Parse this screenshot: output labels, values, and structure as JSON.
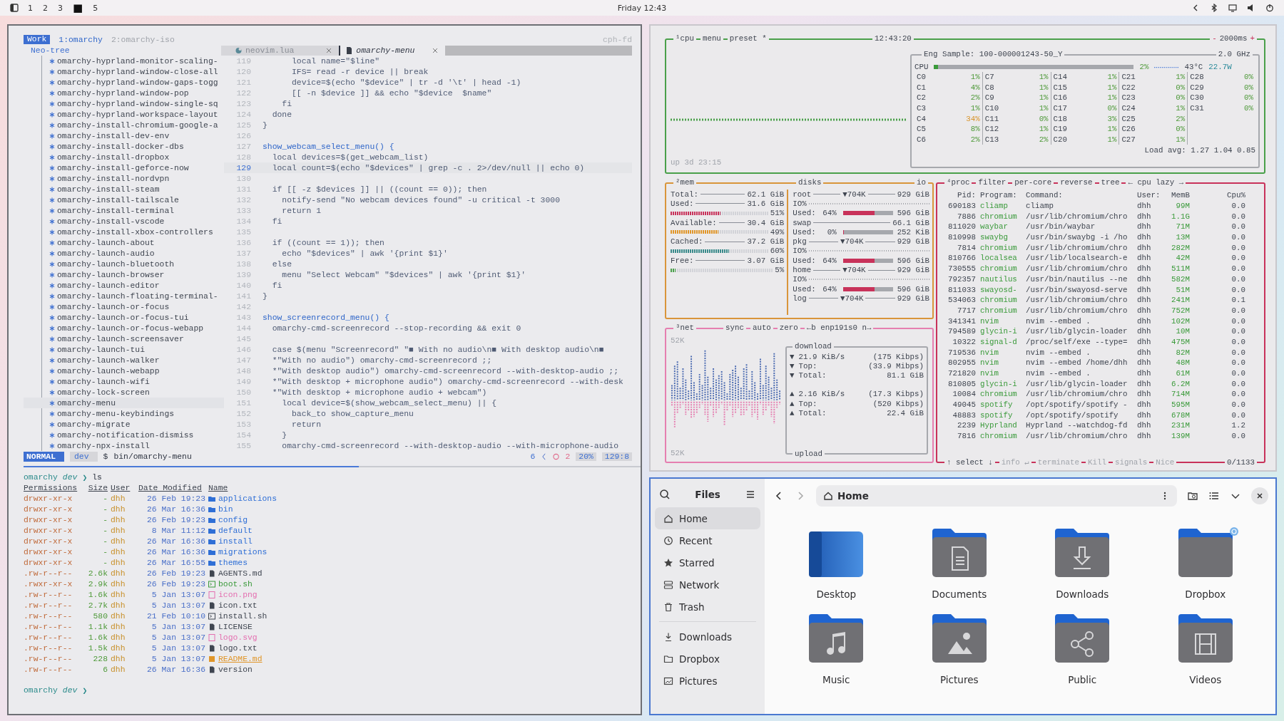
{
  "topbar": {
    "workspaces": [
      {
        "label": "1",
        "selected": false
      },
      {
        "label": "2",
        "selected": false
      },
      {
        "label": "3",
        "selected": false
      },
      {
        "label": "■",
        "selected": true
      },
      {
        "label": "5",
        "selected": false
      }
    ],
    "clock": "Friday 12:43"
  },
  "nvim": {
    "session": "Work",
    "windows": [
      {
        "label": "1:omarchy",
        "selected": true
      },
      {
        "label": "2:omarchy-iso",
        "selected": false
      }
    ],
    "host": "cph-fd",
    "tree_title": "Neo-tree",
    "buffers": [
      {
        "label": "neovim.lua",
        "selected": false
      },
      {
        "label": "omarchy-menu",
        "selected": true
      }
    ],
    "tree": [
      {
        "label": "omarchy-hyprland-monitor-scaling-",
        "selected": false
      },
      {
        "label": "omarchy-hyprland-window-close-all",
        "selected": false
      },
      {
        "label": "omarchy-hyprland-window-gaps-togg",
        "selected": false
      },
      {
        "label": "omarchy-hyprland-window-pop",
        "selected": false
      },
      {
        "label": "omarchy-hyprland-window-single-sq",
        "selected": false
      },
      {
        "label": "omarchy-hyprland-workspace-layout",
        "selected": false
      },
      {
        "label": "omarchy-install-chromium-google-a",
        "selected": false
      },
      {
        "label": "omarchy-install-dev-env",
        "selected": false
      },
      {
        "label": "omarchy-install-docker-dbs",
        "selected": false
      },
      {
        "label": "omarchy-install-dropbox",
        "selected": false
      },
      {
        "label": "omarchy-install-geforce-now",
        "selected": false
      },
      {
        "label": "omarchy-install-nordvpn",
        "selected": false
      },
      {
        "label": "omarchy-install-steam",
        "selected": false
      },
      {
        "label": "omarchy-install-tailscale",
        "selected": false
      },
      {
        "label": "omarchy-install-terminal",
        "selected": false
      },
      {
        "label": "omarchy-install-vscode",
        "selected": false
      },
      {
        "label": "omarchy-install-xbox-controllers",
        "selected": false
      },
      {
        "label": "omarchy-launch-about",
        "selected": false
      },
      {
        "label": "omarchy-launch-audio",
        "selected": false
      },
      {
        "label": "omarchy-launch-bluetooth",
        "selected": false
      },
      {
        "label": "omarchy-launch-browser",
        "selected": false
      },
      {
        "label": "omarchy-launch-editor",
        "selected": false
      },
      {
        "label": "omarchy-launch-floating-terminal-",
        "selected": false
      },
      {
        "label": "omarchy-launch-or-focus",
        "selected": false
      },
      {
        "label": "omarchy-launch-or-focus-tui",
        "selected": false
      },
      {
        "label": "omarchy-launch-or-focus-webapp",
        "selected": false
      },
      {
        "label": "omarchy-launch-screensaver",
        "selected": false
      },
      {
        "label": "omarchy-launch-tui",
        "selected": false
      },
      {
        "label": "omarchy-launch-walker",
        "selected": false
      },
      {
        "label": "omarchy-launch-webapp",
        "selected": false
      },
      {
        "label": "omarchy-launch-wifi",
        "selected": false
      },
      {
        "label": "omarchy-lock-screen",
        "selected": false
      },
      {
        "label": "omarchy-menu",
        "selected": true
      },
      {
        "label": "omarchy-menu-keybindings",
        "selected": false
      },
      {
        "label": "omarchy-migrate",
        "selected": false
      },
      {
        "label": "omarchy-notification-dismiss",
        "selected": false
      },
      {
        "label": "omarchy-npx-install",
        "selected": false
      }
    ],
    "code": [
      {
        "n": "119",
        "text": "      local name=\"$line\"",
        "kind": "code",
        "current": false
      },
      {
        "n": "120",
        "text": "      IFS= read -r device || break",
        "kind": "code",
        "current": false
      },
      {
        "n": "121",
        "text": "      device=$(echo \"$device\" | tr -d '\\t' | head -1)",
        "kind": "code",
        "current": false
      },
      {
        "n": "122",
        "text": "      [[ -n $device ]] && echo \"$device  $name\"",
        "kind": "code",
        "current": false
      },
      {
        "n": "123",
        "text": "    fi",
        "kind": "code",
        "current": false
      },
      {
        "n": "124",
        "text": "  done",
        "kind": "code",
        "current": false
      },
      {
        "n": "125",
        "text": "}",
        "kind": "code",
        "current": false
      },
      {
        "n": "126",
        "current": false
      },
      {
        "n": "127",
        "text": "show_webcam_select_menu() {",
        "kind": "def",
        "current": false
      },
      {
        "n": "128",
        "text": "  local devices=$(get_webcam_list)",
        "kind": "code",
        "current": false
      },
      {
        "n": "129",
        "text": "  local count=$(echo \"$devices\" | grep -c . 2>/dev/null || echo 0)",
        "kind": "code",
        "current": true
      },
      {
        "n": "130",
        "current": false
      },
      {
        "n": "131",
        "text": "  if [[ -z $devices ]] || ((count == 0)); then",
        "kind": "code",
        "current": false
      },
      {
        "n": "132",
        "text": "    notify-send \"No webcam devices found\" -u critical -t 3000",
        "kind": "code",
        "current": false
      },
      {
        "n": "133",
        "text": "    return 1",
        "kind": "code",
        "current": false
      },
      {
        "n": "134",
        "text": "  fi",
        "kind": "code",
        "current": false
      },
      {
        "n": "135",
        "current": false
      },
      {
        "n": "136",
        "text": "  if ((count == 1)); then",
        "kind": "code",
        "current": false
      },
      {
        "n": "137",
        "text": "    echo \"$devices\" | awk '{print $1}'",
        "kind": "code",
        "current": false
      },
      {
        "n": "138",
        "text": "  else",
        "kind": "code",
        "current": false
      },
      {
        "n": "139",
        "text": "    menu \"Select Webcam\" \"$devices\" | awk '{print $1}'",
        "kind": "code",
        "current": false
      },
      {
        "n": "140",
        "text": "  fi",
        "kind": "code",
        "current": false
      },
      {
        "n": "141",
        "text": "}",
        "kind": "code",
        "current": false
      },
      {
        "n": "142",
        "current": false
      },
      {
        "n": "143",
        "text": "show_screenrecord_menu() {",
        "kind": "def",
        "current": false
      },
      {
        "n": "144",
        "text": "  omarchy-cmd-screenrecord --stop-recording && exit 0",
        "kind": "code",
        "current": false
      },
      {
        "n": "145",
        "current": false
      },
      {
        "n": "146",
        "text": "  case $(menu \"Screenrecord\" \"■ With no audio\\n■ With desktop audio\\n■",
        "kind": "code",
        "current": false
      },
      {
        "n": "147",
        "text": "  *\"With no audio\") omarchy-cmd-screenrecord ;;",
        "kind": "code",
        "current": false
      },
      {
        "n": "148",
        "text": "  *\"With desktop audio\") omarchy-cmd-screenrecord --with-desktop-audio ;;",
        "kind": "code",
        "current": false
      },
      {
        "n": "149",
        "text": "  *\"With desktop + microphone audio\") omarchy-cmd-screenrecord --with-desk",
        "kind": "code",
        "current": false
      },
      {
        "n": "150",
        "text": "  *\"With desktop + microphone audio + webcam\")",
        "kind": "code",
        "current": false
      },
      {
        "n": "151",
        "text": "    local device=$(show_webcam_select_menu) || {",
        "kind": "code",
        "current": false
      },
      {
        "n": "152",
        "text": "      back_to show_capture_menu",
        "kind": "code",
        "current": false
      },
      {
        "n": "153",
        "text": "      return",
        "kind": "code",
        "current": false
      },
      {
        "n": "154",
        "text": "    }",
        "kind": "code",
        "current": false
      },
      {
        "n": "155",
        "text": "    omarchy-cmd-screenrecord --with-desktop-audio --with-microphone-audio",
        "kind": "code",
        "current": false
      }
    ],
    "status": {
      "mode": "NORMAL",
      "branch": "dev",
      "filetype": "$",
      "file": "bin/omarchy-menu",
      "count": "6",
      "diagnostics": "2",
      "percent": "20%",
      "position": "129:8"
    }
  },
  "terminal": {
    "prompt": {
      "dir": "omarchy",
      "branch": "dev",
      "symbol": "❯",
      "command": "ls"
    },
    "columns": [
      "Permissions",
      "Size",
      "User",
      "Date Modified",
      "Name"
    ],
    "rows": [
      {
        "perms": "drwxr-xr-x",
        "size": "-",
        "user": "dhh",
        "date": "26 Feb 19:23",
        "name": "applications",
        "kind": "dir"
      },
      {
        "perms": "drwxr-xr-x",
        "size": "-",
        "user": "dhh",
        "date": "26 Mar 16:36",
        "name": "bin",
        "kind": "dir"
      },
      {
        "perms": "drwxr-xr-x",
        "size": "-",
        "user": "dhh",
        "date": "26 Feb 19:23",
        "name": "config",
        "kind": "dir"
      },
      {
        "perms": "drwxr-xr-x",
        "size": "-",
        "user": "dhh",
        "date": "8 Mar 11:12",
        "name": "default",
        "kind": "dir"
      },
      {
        "perms": "drwxr-xr-x",
        "size": "-",
        "user": "dhh",
        "date": "26 Mar 16:36",
        "name": "install",
        "kind": "dir"
      },
      {
        "perms": "drwxr-xr-x",
        "size": "-",
        "user": "dhh",
        "date": "26 Mar 16:36",
        "name": "migrations",
        "kind": "dir"
      },
      {
        "perms": "drwxr-xr-x",
        "size": "-",
        "user": "dhh",
        "date": "26 Mar 16:55",
        "name": "themes",
        "kind": "dir"
      },
      {
        "perms": ".rw-r--r--",
        "size": "2.6k",
        "user": "dhh",
        "date": "26 Feb 19:23",
        "name": "AGENTS.md",
        "kind": "doc"
      },
      {
        "perms": ".rwxr-xr-x",
        "size": "2.9k",
        "user": "dhh",
        "date": "26 Feb 19:23",
        "name": "boot.sh",
        "kind": "exec"
      },
      {
        "perms": ".rw-r--r--",
        "size": "1.6k",
        "user": "dhh",
        "date": "5 Jan 13:07",
        "name": "icon.png",
        "kind": "image"
      },
      {
        "perms": ".rw-r--r--",
        "size": "2.7k",
        "user": "dhh",
        "date": "5 Jan 13:07",
        "name": "icon.txt",
        "kind": "text"
      },
      {
        "perms": ".rw-r--r--",
        "size": "580",
        "user": "dhh",
        "date": "21 Feb 10:10",
        "name": "install.sh",
        "kind": "script"
      },
      {
        "perms": ".rw-r--r--",
        "size": "1.1k",
        "user": "dhh",
        "date": "5 Jan 13:07",
        "name": "LICENSE",
        "kind": "text"
      },
      {
        "perms": ".rw-r--r--",
        "size": "1.6k",
        "user": "dhh",
        "date": "5 Jan 13:07",
        "name": "logo.svg",
        "kind": "image"
      },
      {
        "perms": ".rw-r--r--",
        "size": "1.5k",
        "user": "dhh",
        "date": "5 Jan 13:07",
        "name": "logo.txt",
        "kind": "text"
      },
      {
        "perms": ".rw-r--r--",
        "size": "228",
        "user": "dhh",
        "date": "5 Jan 13:07",
        "name": "README.md",
        "kind": "readme"
      },
      {
        "perms": ".rw-r--r--",
        "size": "6",
        "user": "dhh",
        "date": "26 Mar 16:36",
        "name": "version",
        "kind": "text"
      }
    ],
    "prompt2": {
      "dir": "omarchy",
      "branch": "dev",
      "symbol": "❯"
    }
  },
  "btop": {
    "cpu": {
      "tabs": [
        "¹cpu",
        "menu",
        "preset *"
      ],
      "clock": "12:43:20",
      "minus": "-",
      "interval": "2000ms",
      "plus": "+",
      "uptime": "up 3d 23:15",
      "model": "Eng Sample: 100-000001243-50_Y",
      "freq": "2.0 GHz",
      "total_label": "CPU",
      "level": 0.02,
      "total": "2%",
      "temp": "43°C",
      "power": "22.7W",
      "cores": [
        {
          "name": "C0",
          "pct": "1%"
        },
        {
          "name": "C1",
          "pct": "4%"
        },
        {
          "name": "C2",
          "pct": "2%"
        },
        {
          "name": "C3",
          "pct": "1%"
        },
        {
          "name": "C4",
          "pct": "34%"
        },
        {
          "name": "C5",
          "pct": "8%"
        },
        {
          "name": "C6",
          "pct": "2%"
        },
        {
          "name": "C7",
          "pct": "1%"
        },
        {
          "name": "C8",
          "pct": "1%"
        },
        {
          "name": "C9",
          "pct": "1%"
        },
        {
          "name": "C10",
          "pct": "1%"
        },
        {
          "name": "C11",
          "pct": "0%"
        },
        {
          "name": "C12",
          "pct": "1%"
        },
        {
          "name": "C13",
          "pct": "2%"
        },
        {
          "name": "C14",
          "pct": "1%"
        },
        {
          "name": "C15",
          "pct": "1%"
        },
        {
          "name": "C16",
          "pct": "1%"
        },
        {
          "name": "C17",
          "pct": "0%"
        },
        {
          "name": "C18",
          "pct": "3%"
        },
        {
          "name": "C19",
          "pct": "1%"
        },
        {
          "name": "C20",
          "pct": "1%"
        },
        {
          "name": "C21",
          "pct": "1%"
        },
        {
          "name": "C22",
          "pct": "0%"
        },
        {
          "name": "C23",
          "pct": "0%"
        },
        {
          "name": "C24",
          "pct": "1%"
        },
        {
          "name": "C25",
          "pct": "2%"
        },
        {
          "name": "C26",
          "pct": "0%"
        },
        {
          "name": "C27",
          "pct": "1%"
        },
        {
          "name": "C28",
          "pct": "0%"
        },
        {
          "name": "C29",
          "pct": "0%"
        },
        {
          "name": "C30",
          "pct": "0%"
        },
        {
          "name": "C31",
          "pct": "0%"
        }
      ],
      "load": "Load avg: 1.27 1.04 0.85"
    },
    "mem": {
      "title": "²mem",
      "disks_title": "disks",
      "io_title": "io",
      "stats": [
        {
          "label": "Total:",
          "value": "62.1 GiB"
        },
        {
          "label": "Used:",
          "value": "31.6 GiB",
          "level": 0.51,
          "pct": "51%",
          "color": "#c8325a"
        },
        {
          "label": "Available:",
          "value": "30.4 GiB",
          "level": 0.49,
          "pct": "49%",
          "color": "#e0962a"
        },
        {
          "label": "Cached:",
          "value": "37.2 GiB",
          "level": 0.6,
          "pct": "60%",
          "color": "#3a8a8a"
        },
        {
          "label": "Free:",
          "value": "3.07 GiB",
          "level": 0.05,
          "pct": "5%",
          "color": "#4aa04a"
        }
      ],
      "disks": [
        {
          "name": "root",
          "io": "▼704K",
          "total": "929 GiB",
          "io_label": "IO%",
          "used_label": "Used:",
          "used": "64%",
          "level": 0.64,
          "used_size": "596 GiB"
        },
        {
          "name": "swap",
          "total": "66.1 GiB",
          "used_label": "Used:",
          "used": "0%",
          "level": 0,
          "used_size": "252 KiB"
        },
        {
          "name": "pkg",
          "io": "▼704K",
          "total": "929 GiB",
          "io_label": "IO%",
          "used_label": "Used:",
          "used": "64%",
          "level": 0.64,
          "used_size": "596 GiB"
        },
        {
          "name": "home",
          "io": "▼704K",
          "total": "929 GiB",
          "io_label": "IO%",
          "used_label": "Used:",
          "used": "64%",
          "level": 0.64,
          "used_size": "596 GiB"
        },
        {
          "name": "log",
          "io": "▼704K",
          "total": "929 GiB"
        }
      ]
    },
    "net": {
      "title": "³net",
      "tabs": [
        "sync",
        "auto",
        "zero",
        "←b enp191s0 n→"
      ],
      "scale_top": "52K",
      "scale_bottom": "52K",
      "download_label": "download",
      "upload_label": "upload",
      "download": [
        {
          "arrow": "▼",
          "label": "21.9 KiB/s",
          "value": "(175 Kibps)"
        },
        {
          "arrow": "▼",
          "label": "Top:",
          "value": "(33.9 Mibps)"
        },
        {
          "arrow": "▼",
          "label": "Total:",
          "value": "81.1 GiB"
        }
      ],
      "upload": [
        {
          "arrow": "▲",
          "label": "2.16 KiB/s",
          "value": "(17.3 Kibps)"
        },
        {
          "arrow": "▲",
          "label": "Top:",
          "value": "(520 Kibps)"
        },
        {
          "arrow": "▲",
          "label": "Total:",
          "value": "22.4 GiB"
        }
      ]
    },
    "proc": {
      "tabs": [
        "⁴proc",
        "filter",
        "per-core",
        "reverse",
        "tree",
        "← cpu lazy →"
      ],
      "columns": [
        "Pid:",
        "Program:",
        "Command:",
        "User:",
        "MemB",
        "Cpu%"
      ],
      "rows": [
        [
          "690183",
          "cliamp",
          "cliamp",
          "dhh",
          "99M",
          "0.0"
        ],
        [
          "7886",
          "chromium",
          "/usr/lib/chromium/chro",
          "dhh",
          "1.1G",
          "0.0"
        ],
        [
          "811020",
          "waybar",
          "/usr/bin/waybar",
          "dhh",
          "71M",
          "0.0"
        ],
        [
          "810998",
          "swaybg",
          "/usr/bin/swaybg -i /ho",
          "dhh",
          "13M",
          "0.0"
        ],
        [
          "7814",
          "chromium",
          "/usr/lib/chromium/chro",
          "dhh",
          "282M",
          "0.0"
        ],
        [
          "810766",
          "localsea",
          "/usr/lib/localsearch-e",
          "dhh",
          "42M",
          "0.0"
        ],
        [
          "730555",
          "chromium",
          "/usr/lib/chromium/chro",
          "dhh",
          "511M",
          "0.0"
        ],
        [
          "792357",
          "nautilus",
          "/usr/bin/nautilus --ne",
          "dhh",
          "582M",
          "0.0"
        ],
        [
          "811033",
          "swayosd-",
          "/usr/bin/swayosd-serve",
          "dhh",
          "51M",
          "0.0"
        ],
        [
          "534063",
          "chromium",
          "/usr/lib/chromium/chro",
          "dhh",
          "241M",
          "0.1"
        ],
        [
          "7717",
          "chromium",
          "/usr/lib/chromium/chro",
          "dhh",
          "752M",
          "0.0"
        ],
        [
          "341341",
          "nvim",
          "nvim --embed .",
          "dhh",
          "102M",
          "0.0"
        ],
        [
          "794589",
          "glycin-i",
          "/usr/lib/glycin-loader",
          "dhh",
          "10M",
          "0.0"
        ],
        [
          "10322",
          "signal-d",
          "/proc/self/exe --type=",
          "dhh",
          "475M",
          "0.0"
        ],
        [
          "719536",
          "nvim",
          "nvim --embed .",
          "dhh",
          "82M",
          "0.0"
        ],
        [
          "802955",
          "nvim",
          "nvim --embed /home/dhh",
          "dhh",
          "48M",
          "0.0"
        ],
        [
          "721820",
          "nvim",
          "nvim --embed .",
          "dhh",
          "61M",
          "0.0"
        ],
        [
          "810805",
          "glycin-i",
          "/usr/lib/glycin-loader",
          "dhh",
          "6.2M",
          "0.0"
        ],
        [
          "10084",
          "chromium",
          "/usr/lib/chromium/chro",
          "dhh",
          "714M",
          "0.0"
        ],
        [
          "49045",
          "spotify",
          "/opt/spotify/spotify -",
          "dhh",
          "595M",
          "0.0"
        ],
        [
          "48883",
          "spotify",
          "/opt/spotify/spotify",
          "dhh",
          "678M",
          "0.0"
        ],
        [
          "2239",
          "Hyprland",
          "Hyprland --watchdog-fd",
          "dhh",
          "231M",
          "1.2"
        ],
        [
          "7816",
          "chromium",
          "/usr/lib/chromium/chro",
          "dhh",
          "139M",
          "0.0"
        ]
      ],
      "footer": [
        "↑ select ↓",
        "info ↵",
        "terminate",
        "Kill",
        "signals",
        "Nice"
      ],
      "count": "0/1133"
    }
  },
  "files": {
    "title": "Files",
    "path": "Home",
    "sidebar": [
      {
        "label": "Home",
        "selected": true
      },
      {
        "label": "Recent",
        "selected": false
      },
      {
        "label": "Starred",
        "selected": false
      },
      {
        "label": "Network",
        "selected": false
      },
      {
        "label": "Trash",
        "selected": false
      },
      {
        "label": "Downloads",
        "selected": false
      },
      {
        "label": "Dropbox",
        "selected": false
      },
      {
        "label": "Pictures",
        "selected": false
      }
    ],
    "folders": [
      {
        "label": "Desktop",
        "kind": "desktop"
      },
      {
        "label": "Documents",
        "kind": "documents"
      },
      {
        "label": "Downloads",
        "kind": "downloads"
      },
      {
        "label": "Dropbox",
        "kind": "synced"
      },
      {
        "label": "Music",
        "kind": "music"
      },
      {
        "label": "Pictures",
        "kind": "pictures"
      },
      {
        "label": "Public",
        "kind": "public"
      },
      {
        "label": "Videos",
        "kind": "videos"
      }
    ]
  }
}
